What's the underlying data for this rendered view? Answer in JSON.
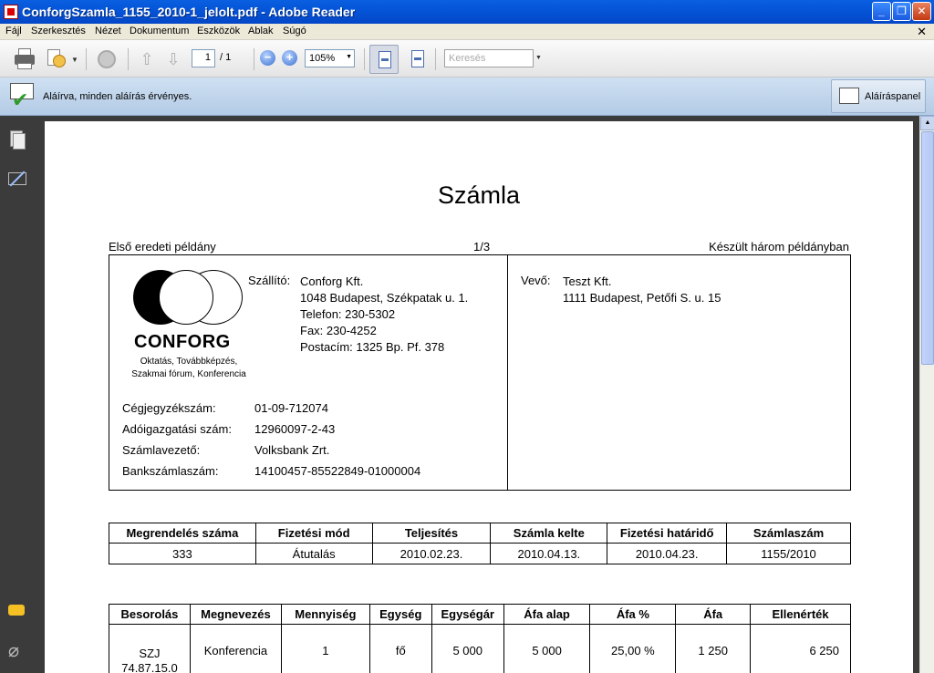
{
  "window": {
    "title": "ConforgSzamla_1155_2010-1_jelolt.pdf - Adobe Reader",
    "btn_minimize": "_",
    "btn_maximize": "❐",
    "btn_close": "✕"
  },
  "menu": {
    "items": [
      "Fájl",
      "Szerkesztés",
      "Nézet",
      "Dokumentum",
      "Eszközök",
      "Ablak",
      "Súgó"
    ],
    "close_glyph": "✕"
  },
  "toolbar": {
    "page_current": "1",
    "page_total": "/ 1",
    "zoom": "105%",
    "search_placeholder": "Keresés",
    "prev_glyph": "⇧",
    "next_glyph": "⇩",
    "zoom_out_glyph": "−",
    "zoom_in_glyph": "+"
  },
  "signature_bar": {
    "status": "Aláírva, minden aláírás érvényes.",
    "panel_button": "Aláíráspanel"
  },
  "invoice": {
    "title": "Számla",
    "copy_label": "Első eredeti példány",
    "page_of": "1/3",
    "copies_note": "Készült három példányban",
    "logo_name": "CONFORG",
    "logo_sub": [
      "Oktatás, Továbbképzés,",
      "Szakmai fórum, Konferencia"
    ],
    "supplier": {
      "label": "Szállító:",
      "lines": [
        "Conforg Kft.",
        "1048 Budapest, Székpatak u. 1.",
        "Telefon: 230-5302",
        "Fax: 230-4252",
        "Postacím: 1325 Bp. Pf. 378"
      ]
    },
    "buyer": {
      "label": "Vevő:",
      "lines": [
        "Teszt Kft.",
        "1111 Budapest, Petőfi S. u. 15"
      ]
    },
    "registry": [
      {
        "label": "Cégjegyzékszám:",
        "value": "01-09-712074"
      },
      {
        "label": "Adóigazgatási szám:",
        "value": "12960097-2-43"
      },
      {
        "label": "Számlavezető:",
        "value": "Volksbank Zrt."
      },
      {
        "label": "Bankszámlaszám:",
        "value": "14100457-85522849-01000004"
      }
    ],
    "order_table": {
      "headers": [
        "Megrendelés száma",
        "Fizetési mód",
        "Teljesítés",
        "Számla kelte",
        "Fizetési határidő",
        "Számlaszám"
      ],
      "row": [
        "333",
        "Átutalás",
        "2010.02.23.",
        "2010.04.13.",
        "2010.04.23.",
        "1155/2010"
      ]
    },
    "items_table": {
      "headers": [
        "Besorolás",
        "Megnevezés",
        "Mennyiség",
        "Egység",
        "Egységár",
        "Áfa alap",
        "Áfa %",
        "Áfa",
        "Ellenérték"
      ],
      "row": {
        "besorolas_1": "SZJ",
        "besorolas_2": "74.87.15.0",
        "megnevezes": "Konferencia",
        "mennyiseg": "1",
        "egyseg": "fő",
        "egysegar": "5 000",
        "afa_alap": "5 000",
        "afa_pct": "25,00 %",
        "afa": "1 250",
        "ellenertek": "6 250"
      }
    }
  }
}
